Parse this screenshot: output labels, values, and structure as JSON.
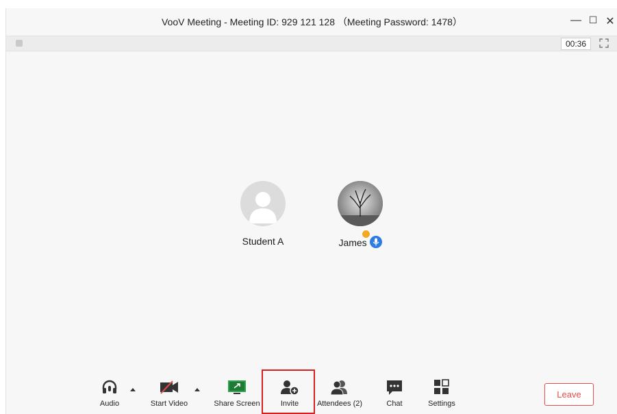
{
  "window": {
    "title": "VooV Meeting - Meeting ID: 929 121 128 （Meeting Password: 1478）",
    "controls": {
      "minimize": "—",
      "maximize": "☐",
      "close": "✕"
    }
  },
  "statusbar": {
    "timer": "00:36"
  },
  "participants": [
    {
      "name": "Student A",
      "avatar_icon": "default-person-avatar"
    },
    {
      "name": "James",
      "avatar_icon": "tree-photo-avatar",
      "badge_icon": "host-badge-icon",
      "mic_icon": "microphone-active-icon"
    }
  ],
  "toolbar": {
    "audio": "Audio",
    "start_video": "Start Video",
    "share_screen": "Share Screen",
    "invite": "Invite",
    "attendees": "Attendees (2)",
    "chat": "Chat",
    "settings": "Settings",
    "leave": "Leave"
  },
  "colors": {
    "leave": "#e84c4c",
    "highlight": "#d81e1e",
    "share_green": "#2ea34a",
    "mic_blue": "#2f7ae5",
    "host_orange": "#f5a623"
  }
}
